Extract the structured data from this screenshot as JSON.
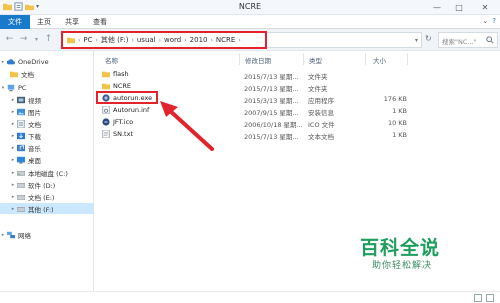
{
  "window": {
    "title": "NCRE"
  },
  "ribbon": {
    "tabs": [
      "文件",
      "主页",
      "共享",
      "查看"
    ]
  },
  "address": {
    "crumbs": [
      "PC",
      "其他 (F:)",
      "usual",
      "word",
      "2010",
      "NCRE"
    ],
    "search_placeholder": "搜索\"NC...\""
  },
  "nav": {
    "items": [
      {
        "label": "OneDrive",
        "icon": "cloud-icon"
      },
      {
        "label": "文档",
        "icon": "folder-icon"
      },
      {
        "label": "PC",
        "icon": "computer-icon"
      },
      {
        "label": "视频",
        "icon": "video-folder-icon"
      },
      {
        "label": "图片",
        "icon": "picture-folder-icon"
      },
      {
        "label": "文档",
        "icon": "document-folder-icon"
      },
      {
        "label": "下载",
        "icon": "download-folder-icon"
      },
      {
        "label": "音乐",
        "icon": "music-folder-icon"
      },
      {
        "label": "桌面",
        "icon": "desktop-folder-icon"
      },
      {
        "label": "本地磁盘 (C:)",
        "icon": "drive-icon"
      },
      {
        "label": "软件 (D:)",
        "icon": "drive-icon"
      },
      {
        "label": "文档 (E:)",
        "icon": "drive-icon"
      },
      {
        "label": "其他 (F:)",
        "icon": "drive-icon"
      },
      {
        "label": "网络",
        "icon": "network-icon"
      }
    ]
  },
  "columns": {
    "name": "名称",
    "date": "修改日期",
    "type": "类型",
    "size": "大小"
  },
  "files": [
    {
      "name": "flash",
      "date": "2015/7/13 星期...",
      "type": "文件夹",
      "size": "",
      "icon": "folder-icon"
    },
    {
      "name": "NCRE",
      "date": "2015/7/13 星期...",
      "type": "文件夹",
      "size": "",
      "icon": "folder-icon"
    },
    {
      "name": "autorun.exe",
      "date": "2015/3/13 星期...",
      "type": "应用程序",
      "size": "176 KB",
      "icon": "exe-icon"
    },
    {
      "name": "Autorun.inf",
      "date": "2007/9/15 星期...",
      "type": "安装信息",
      "size": "1 KB",
      "icon": "settings-file-icon"
    },
    {
      "name": "JFT.ico",
      "date": "2006/10/18 星期...",
      "type": "ICO 文件",
      "size": "10 KB",
      "icon": "ico-file-icon"
    },
    {
      "name": "SN.txt",
      "date": "2015/7/13 星期...",
      "type": "文本文档",
      "size": "1 KB",
      "icon": "text-file-icon"
    }
  ],
  "watermark": {
    "title": "百科全说",
    "subtitle": "助你轻松解决"
  },
  "colors": {
    "accent": "#1979ca",
    "highlight": "#e3232b",
    "selection": "#cce8ff",
    "watermark": "#1e9e5e"
  }
}
